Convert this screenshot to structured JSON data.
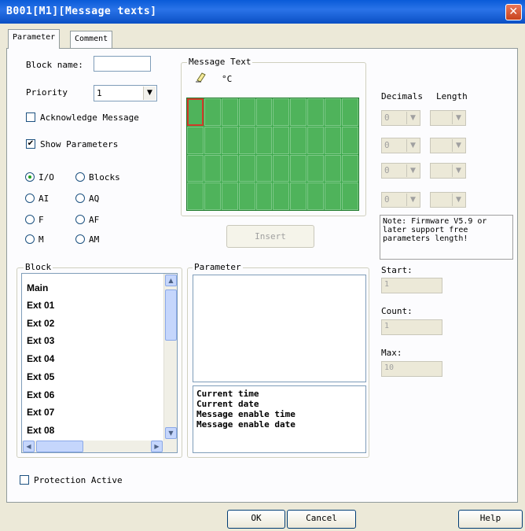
{
  "window": {
    "title": "B001[M1][Message texts]",
    "close": "✕"
  },
  "tabs": [
    {
      "label": "Parameter",
      "active": true
    },
    {
      "label": "Comment",
      "active": false
    }
  ],
  "form": {
    "block_name_label": "Block name:",
    "block_name_value": "",
    "priority_label": "Priority",
    "priority_value": "1",
    "acknowledge_label": "Acknowledge Message",
    "acknowledge_checked": false,
    "show_params_label": "Show Parameters",
    "show_params_checked": true
  },
  "radios": [
    {
      "label": "I/O",
      "checked": true
    },
    {
      "label": "Blocks",
      "checked": false
    },
    {
      "label": "AI",
      "checked": false
    },
    {
      "label": "AQ",
      "checked": false
    },
    {
      "label": "F",
      "checked": false
    },
    {
      "label": "AF",
      "checked": false
    },
    {
      "label": "M",
      "checked": false
    },
    {
      "label": "AM",
      "checked": false
    }
  ],
  "message_text": {
    "title": "Message Text",
    "degree_symbol": "°C",
    "rows": 4,
    "cols": 10
  },
  "insert_button": "Insert",
  "decimals": {
    "decimals_label": "Decimals",
    "length_label": "Length",
    "rows": [
      "0",
      "0",
      "0",
      "0"
    ]
  },
  "note": "Note: Firmware V5.9 or later support free parameters length!",
  "block": {
    "title": "Block",
    "items": [
      "Main",
      "Ext 01",
      "Ext 02",
      "Ext 03",
      "Ext 04",
      "Ext 05",
      "Ext 06",
      "Ext 07",
      "Ext 08"
    ]
  },
  "parameter": {
    "title": "Parameter",
    "items": [
      "Current time",
      "Current date",
      "Message enable time",
      "Message enable date"
    ]
  },
  "range": {
    "start_label": "Start:",
    "start_value": "1",
    "count_label": "Count:",
    "count_value": "1",
    "max_label": "Max:",
    "max_value": "10"
  },
  "protection": {
    "label": "Protection Active",
    "checked": false
  },
  "footer": {
    "ok": "OK",
    "cancel": "Cancel",
    "help": "Help"
  },
  "colors": {
    "grid_green": "#4fb35b",
    "title_blue": "#0a5bd8",
    "selected_cell": "#d23a2a"
  }
}
